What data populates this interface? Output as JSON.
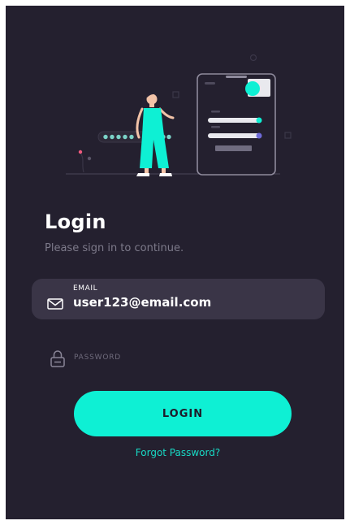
{
  "login": {
    "title": "Login",
    "subtitle": "Please sign in to continue.",
    "email": {
      "label": "EMAIL",
      "value": "user123@email.com",
      "icon": "mail-icon"
    },
    "password": {
      "placeholder": "PASSWORD",
      "value": "",
      "icon": "lock-icon"
    },
    "login_button_label": "LOGIN",
    "forgot_password_label": "Forgot Password?"
  },
  "colors": {
    "background": "#24202f",
    "field_background": "#3a3547",
    "accent": "#0ef0d4",
    "text_primary": "#ffffff",
    "text_muted": "#7d7a8a"
  }
}
